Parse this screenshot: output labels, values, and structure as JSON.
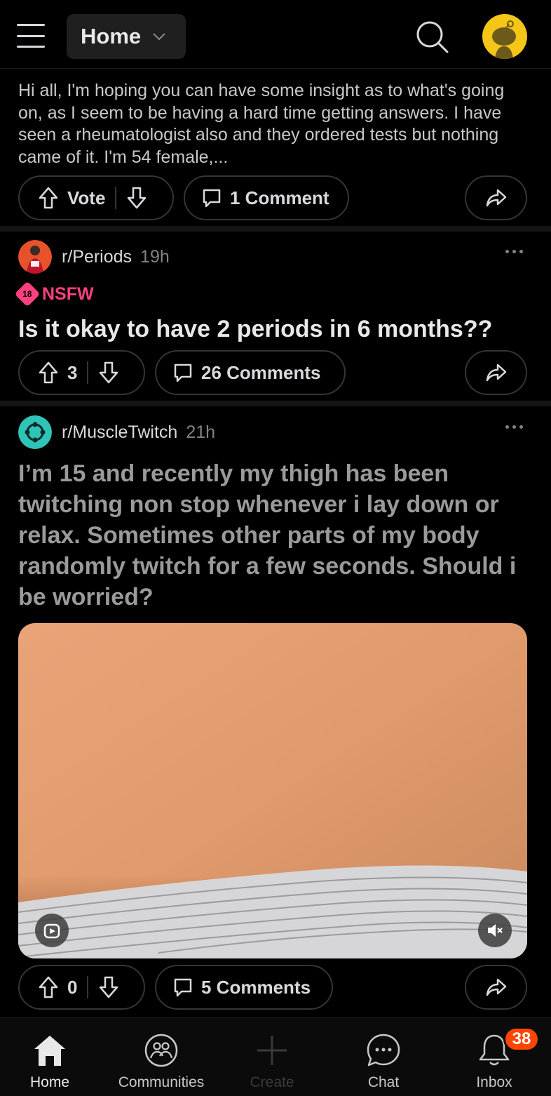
{
  "header": {
    "feed_label": "Home"
  },
  "posts": [
    {
      "body": "Hi all, I'm hoping you can have some insight as to what's going on, as I seem to be having a hard time getting answers. I have seen a rheumatologist also and they ordered tests but nothing came of it. I'm 54 female,...",
      "vote_label": "Vote",
      "comments_label": "1 Comment"
    },
    {
      "subreddit": "r/Periods",
      "age": "19h",
      "nsfw_badge": "18",
      "nsfw_label": "NSFW",
      "title": "Is it okay to have 2 periods in 6 months??",
      "votes": "3",
      "comments_label": "26 Comments"
    },
    {
      "subreddit": "r/MuscleTwitch",
      "age": "21h",
      "title": "I’m 15 and recently my thigh has been twitching non stop whenever i lay down or relax. Sometimes other parts of my body randomly twitch for a few seconds. Should i be worried?",
      "votes": "0",
      "comments_label": "5 Comments"
    }
  ],
  "bottom_nav": {
    "items": [
      {
        "label": "Home",
        "icon": "home-icon",
        "active": true
      },
      {
        "label": "Communities",
        "icon": "communities-icon"
      },
      {
        "label": "Create",
        "icon": "plus-icon"
      },
      {
        "label": "Chat",
        "icon": "chat-icon"
      },
      {
        "label": "Inbox",
        "icon": "bell-icon"
      }
    ],
    "inbox_badge": "38"
  },
  "colors": {
    "background": "#000000",
    "nsfw": "#ff4080",
    "badge": "#ff4500",
    "avatar": "#f5c518"
  }
}
